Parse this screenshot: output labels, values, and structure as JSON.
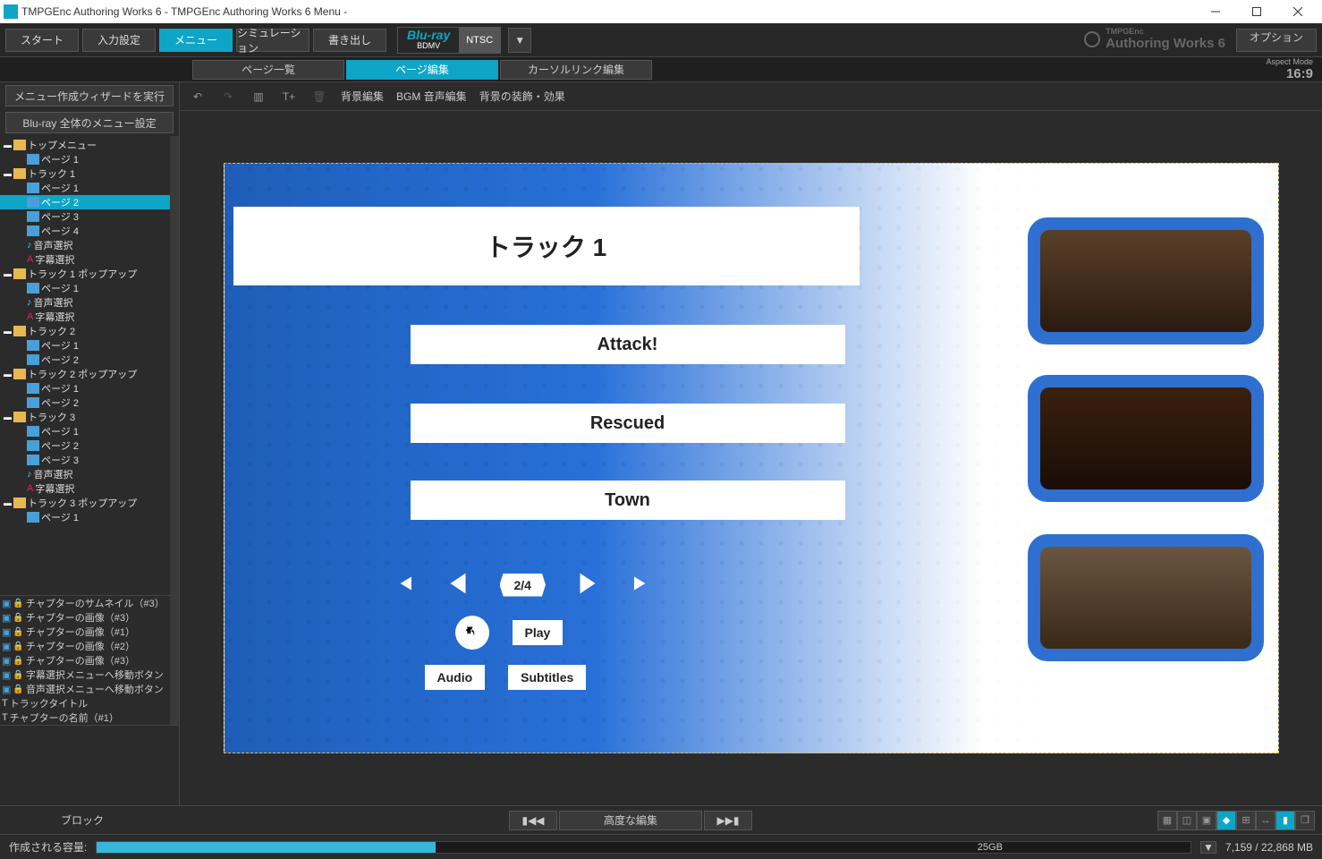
{
  "window": {
    "title": "TMPGEnc Authoring Works 6 - TMPGEnc Authoring Works 6 Menu -"
  },
  "toolbar": {
    "start": "スタート",
    "input": "入力設定",
    "menu": "メニュー",
    "sim": "シミュレーション",
    "output": "書き出し",
    "format_top": "Blu-ray",
    "format_bottom": "BDMV",
    "standard": "NTSC",
    "brand_small": "TMPGEnc",
    "brand_big": "Authoring Works 6",
    "options": "オプション"
  },
  "tabs": {
    "list": "ページ一覧",
    "edit": "ページ編集",
    "cursor": "カーソルリンク編集",
    "aspect_lbl": "Aspect Mode",
    "aspect_val": "16:9"
  },
  "sidebar": {
    "wizard": "メニュー作成ウィザードを実行",
    "global": "Blu-ray 全体のメニュー設定"
  },
  "tree": {
    "top": "トップメニュー",
    "page1": "ページ 1",
    "page2": "ページ 2",
    "page3": "ページ 3",
    "page4": "ページ 4",
    "audio_sel": "音声選択",
    "sub_sel": "字幕選択",
    "track1": "トラック 1",
    "track1_popup": "トラック 1 ポップアップ",
    "track2": "トラック 2",
    "track2_popup": "トラック 2 ポップアップ",
    "track3": "トラック 3",
    "track3_popup": "トラック 3 ポップアップ"
  },
  "props": {
    "p1": "チャプターのサムネイル（#3）",
    "p2": "チャプターの画像（#3）",
    "p3": "チャプターの画像（#1）",
    "p4": "チャプターの画像（#2）",
    "p5": "チャプターの画像（#3）",
    "p6": "字幕選択メニューへ移動ボタン",
    "p7": "音声選択メニューへ移動ボタン",
    "p8": "トラックタイトル",
    "p9": "チャプターの名前（#1）"
  },
  "edittool": {
    "bg": "背景編集",
    "bgm": "BGM 音声編集",
    "decor": "背景の装飾・効果"
  },
  "menu_preview": {
    "title": "トラック 1",
    "ch1": "Attack!",
    "ch2": "Rescued",
    "ch3": "Town",
    "page": "2/4",
    "play": "Play",
    "audio": "Audio",
    "subtitles": "Subtitles"
  },
  "editbar": {
    "mode": "ブロック",
    "advanced": "高度な編集"
  },
  "status": {
    "label": "作成される容量:",
    "storage": "25GB",
    "usage": "7,159 / 22,868 MB"
  }
}
